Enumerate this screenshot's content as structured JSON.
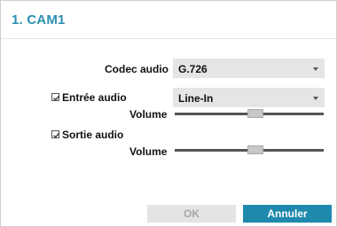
{
  "dialog": {
    "title": "1. CAM1",
    "codec": {
      "label": "Codec audio",
      "value": "G.726"
    },
    "input": {
      "label": "Entrée audio",
      "checked": true,
      "source": "Line-In"
    },
    "input_volume": {
      "label": "Volume",
      "level": 0.54
    },
    "output": {
      "label": "Sortie audio",
      "checked": true
    },
    "output_volume": {
      "label": "Volume",
      "level": 0.54
    },
    "buttons": {
      "ok": "OK",
      "cancel": "Annuler"
    }
  },
  "colors": {
    "title": "#2a8fb0",
    "primary_button": "#1e88ad",
    "disabled_button": "#e4e4e4"
  },
  "icons": {
    "dropdown": "chevron-down-icon",
    "checkbox": "checkbox-checked-icon"
  }
}
